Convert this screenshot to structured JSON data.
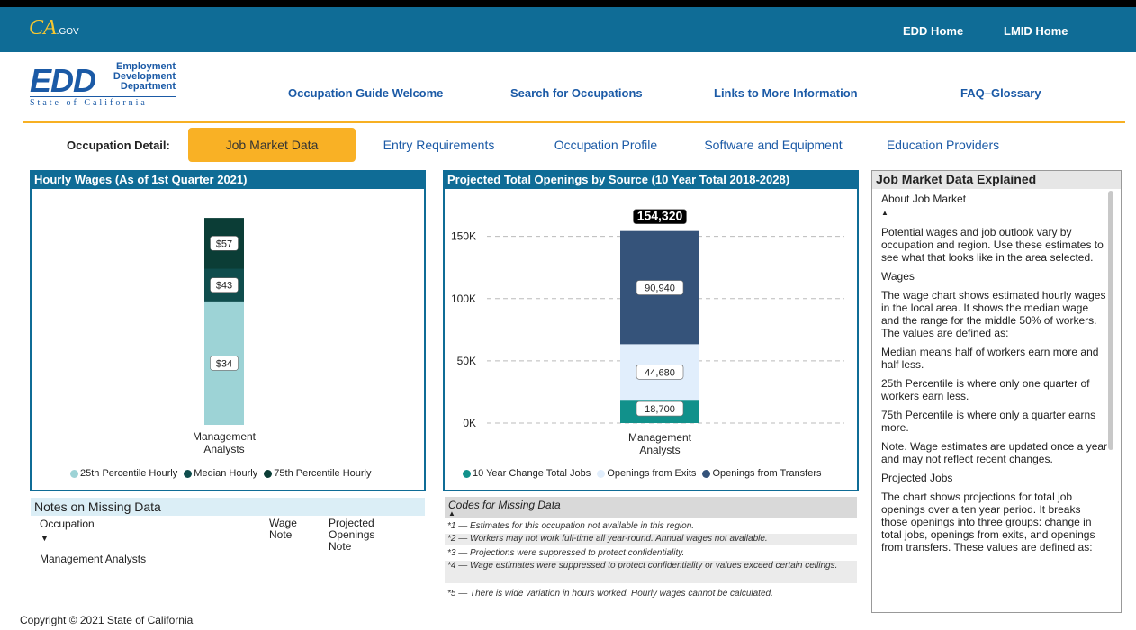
{
  "topbar": {
    "cagov": "CA",
    "cagov_suffix": ".GOV",
    "links": [
      "EDD Home",
      "LMID Home"
    ]
  },
  "logo": {
    "big": "EDD",
    "sub1": "Employment",
    "sub2": "Development",
    "sub3": "Department",
    "state": "State of California"
  },
  "nav": [
    "Occupation Guide Welcome",
    "Search for Occupations",
    "Links to More Information",
    "FAQ–Glossary"
  ],
  "occupation_detail": {
    "label": "Occupation Detail:",
    "tabs": [
      "Job Market Data",
      "Entry Requirements",
      "Occupation Profile",
      "Software and Equipment",
      "Education Providers"
    ],
    "active_tab": "Job Market Data"
  },
  "wages": {
    "title": "Hourly Wages (As of 1st Quarter 2021)",
    "legend": [
      "25th Percentile Hourly",
      "Median Hourly",
      "75th Percentile Hourly"
    ]
  },
  "openings": {
    "title": "Projected Total Openings by Source (10 Year Total 2018-2028)",
    "total_label": "154,320",
    "legend": [
      "10 Year Change Total Jobs",
      "Openings from Exits",
      "Openings from Transfers"
    ]
  },
  "chart_data": [
    {
      "type": "bar",
      "title": "Hourly Wages (As of 1st Quarter 2021)",
      "categories": [
        "Management Analysts"
      ],
      "series": [
        {
          "name": "25th Percentile Hourly",
          "values": [
            34
          ],
          "label": "$34",
          "color": "#9dd3d6"
        },
        {
          "name": "Median Hourly",
          "values": [
            43
          ],
          "label": "$43",
          "color": "#0f4d4d"
        },
        {
          "name": "75th Percentile Hourly",
          "values": [
            57
          ],
          "label": "$57",
          "color": "#0b3d36"
        }
      ],
      "ylim": [
        0,
        60
      ]
    },
    {
      "type": "bar",
      "stacked": true,
      "title": "Projected Total Openings by Source (10 Year Total 2018-2028)",
      "categories": [
        "Management Analysts"
      ],
      "series": [
        {
          "name": "10 Year Change Total Jobs",
          "values": [
            18700
          ],
          "label": "18,700",
          "color": "#11918b"
        },
        {
          "name": "Openings from Exits",
          "values": [
            44680
          ],
          "label": "44,680",
          "color": "#e1eefc"
        },
        {
          "name": "Openings from Transfers",
          "values": [
            90940
          ],
          "label": "90,940",
          "color": "#35537a"
        }
      ],
      "yticks": [
        0,
        50000,
        100000,
        150000
      ],
      "ytick_labels": [
        "0K",
        "50K",
        "100K",
        "150K"
      ],
      "ylim": [
        0,
        170000
      ],
      "grid": true
    }
  ],
  "notes": {
    "title": "Notes on Missing Data",
    "columns": [
      "Occupation",
      "Wage Note",
      "Projected Openings Note"
    ],
    "rows": [
      "Management Analysts"
    ]
  },
  "codes": {
    "title": "Codes for Missing Data",
    "items": [
      "*1 — Estimates for this occupation not available in this region.",
      "*2 — Workers may not work full-time all year-round. Annual wages not available.",
      "*3 — Projections were suppressed to protect confidentiality.",
      "*4 — Wage estimates were suppressed to protect confidentiality or values exceed certain ceilings.",
      "*5 — There is wide variation in hours worked. Hourly wages cannot be calculated."
    ]
  },
  "explained": {
    "title": "Job Market Data Explained",
    "paragraphs": [
      "About Job Market",
      "Potential wages and job outlook vary by occupation and region. Use these estimates to see what that looks like in the area selected.",
      "Wages",
      "The wage chart shows estimated hourly wages in the local area. It shows the median wage and the range for the middle 50% of workers. The values are defined as:",
      "Median means half of workers earn more and half less.",
      "25th Percentile is where only one quarter of workers earn less.",
      "75th Percentile is where only a quarter earns more.",
      "Note. Wage estimates are updated once a year and may not reflect recent changes.",
      "Projected Jobs",
      "The chart shows projections for total job openings over a ten year period. It breaks those openings into three groups: change in total jobs, openings from exits, and openings from transfers. These values are defined as:"
    ]
  },
  "copyright": "Copyright © 2021 State of California"
}
